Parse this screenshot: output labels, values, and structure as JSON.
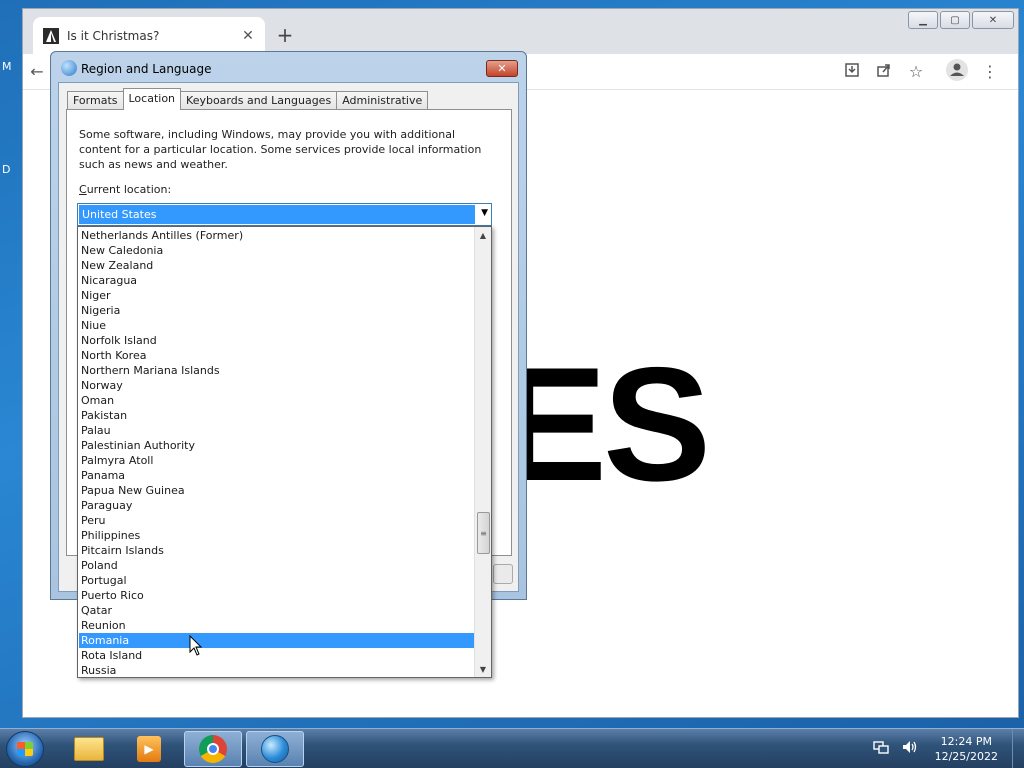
{
  "desktop": {
    "edge_letters": [
      "M",
      "D"
    ]
  },
  "browser": {
    "tab_title": "Is it Christmas?",
    "tab_close": "✕",
    "new_tab": "+",
    "page_big_text": "ES"
  },
  "dialog": {
    "title": "Region and Language",
    "close_label": "✕",
    "tabs": [
      "Formats",
      "Location",
      "Keyboards and Languages",
      "Administrative"
    ],
    "active_tab": "Location",
    "description": "Some software, including Windows, may provide you with additional content for a particular location. Some services provide local information such as news and weather.",
    "current_location_label_accel": "C",
    "current_location_label_rest": "urrent location:",
    "combo_value": "United States",
    "list_items": [
      "Netherlands Antilles (Former)",
      "New Caledonia",
      "New Zealand",
      "Nicaragua",
      "Niger",
      "Nigeria",
      "Niue",
      "Norfolk Island",
      "North Korea",
      "Northern Mariana Islands",
      "Norway",
      "Oman",
      "Pakistan",
      "Palau",
      "Palestinian Authority",
      "Palmyra Atoll",
      "Panama",
      "Papua New Guinea",
      "Paraguay",
      "Peru",
      "Philippines",
      "Pitcairn Islands",
      "Poland",
      "Portugal",
      "Puerto Rico",
      "Qatar",
      "Reunion",
      "Romania",
      "Rota Island",
      "Russia"
    ],
    "selected_item": "Romania"
  },
  "taskbar": {
    "time": "12:24 PM",
    "date": "12/25/2022"
  }
}
